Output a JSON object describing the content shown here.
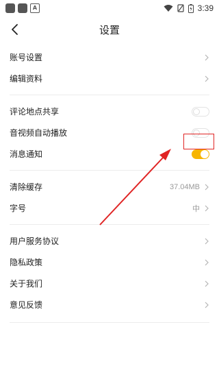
{
  "status_bar": {
    "time": "3:39"
  },
  "header": {
    "title": "设置"
  },
  "groups": [
    {
      "items": [
        {
          "label": "账号设置"
        },
        {
          "label": "编辑资料"
        }
      ]
    },
    {
      "items": [
        {
          "label": "评论地点共享",
          "toggle": false
        },
        {
          "label": "音视频自动播放",
          "toggle": false
        },
        {
          "label": "消息通知",
          "toggle": true
        }
      ]
    },
    {
      "items": [
        {
          "label": "清除缓存",
          "value": "37.04MB"
        },
        {
          "label": "字号",
          "value": "中"
        }
      ]
    },
    {
      "items": [
        {
          "label": "用户服务协议"
        },
        {
          "label": "隐私政策"
        },
        {
          "label": "关于我们"
        },
        {
          "label": "意见反馈"
        }
      ]
    }
  ],
  "colors": {
    "toggle_on": "#f7b500",
    "annotation": "#e02424"
  }
}
